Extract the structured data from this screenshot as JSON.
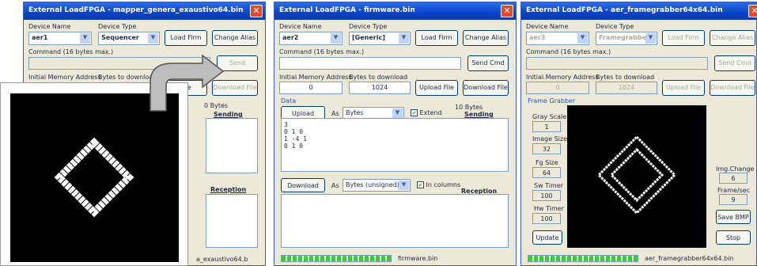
{
  "w1": {
    "title": "External LoadFPGA - mapper_genera_exaustivo64.bin",
    "device_name_label": "Device Name",
    "device_type_label": "Device Type",
    "device": "aer1",
    "type": "Sequencer",
    "load_firm": "Load Firm",
    "change_alias": "Change Alias",
    "command_label": "Command  (16 bytes max.)",
    "send_cmd": "Send",
    "init_mem_label": "Initial Memory Address",
    "bytes_dl_label": "Bytes to download",
    "upload_file": "File",
    "download_file": "Download File",
    "bytes": "0 Bytes",
    "sending": "Sending buffer",
    "reception": "Reception buffer",
    "status": "a_exaustivo64.b"
  },
  "w2": {
    "title": "External LoadFPGA - firmware.bin",
    "device_name_label": "Device Name",
    "device_type_label": "Device Type",
    "device": "aer2",
    "type": "[Generic]",
    "load_firm": "Load Firm",
    "change_alias": "Change Alias",
    "command_label": "Command  (16 bytes max.)",
    "send_cmd": "Send Cmd",
    "init_mem_label": "Initial Memory Address",
    "bytes_dl_label": "Bytes to download",
    "init_mem": "0",
    "bytes_dl": "1024",
    "upload_file": "Upload File",
    "download_file": "Download File",
    "data_label": "Data",
    "upload": "Upload",
    "as": "As",
    "as_upload": "Bytes",
    "extend": "Extend",
    "bytes": "10 Bytes",
    "sending": "Sending buffer",
    "sending_text": "3\n0 1 0\n1 -4 1\n0 1 0",
    "download": "Download",
    "as_download": "Bytes (unsigned)",
    "in_columns": "In columns",
    "reception": "Reception buffer",
    "status": "firmware.bin"
  },
  "w3": {
    "title": "External LoadFPGA - aer_framegrabber64x64.bin",
    "device_name_label": "Device Name",
    "device_type_label": "Device Type",
    "device": "aer3",
    "type": "Framegrabber",
    "load_firm": "Load Firm",
    "change_alias": "Change Alias",
    "command_label": "Command  (16 bytes max.)",
    "send_cmd": "Send Cmd",
    "init_mem_label": "Initial Memory Address",
    "bytes_dl_label": "Bytes to download",
    "init_mem": "0",
    "bytes_dl": "1024",
    "upload_file": "Upload File",
    "download_file": "Download File",
    "frame_grabber": "Frame Grabber",
    "gray_scale_label": "Gray Scale",
    "gray_scale": "1",
    "image_size_label": "Image Size",
    "image_size": "32",
    "fg_size_label": "Fg Size",
    "fg_size": "64",
    "sw_timer_label": "Sw Timer",
    "sw_timer": "100",
    "hw_timer_label": "Hw Timer",
    "hw_timer": "100",
    "update": "Update",
    "img_change_label": "Img.Change",
    "img_change": "6",
    "frame_sec_label": "Frame/sec",
    "frame_sec": "9",
    "save_bmp": "Save BMP",
    "stop": "Stop",
    "status": "aer_framegrabber64x64.bin"
  }
}
